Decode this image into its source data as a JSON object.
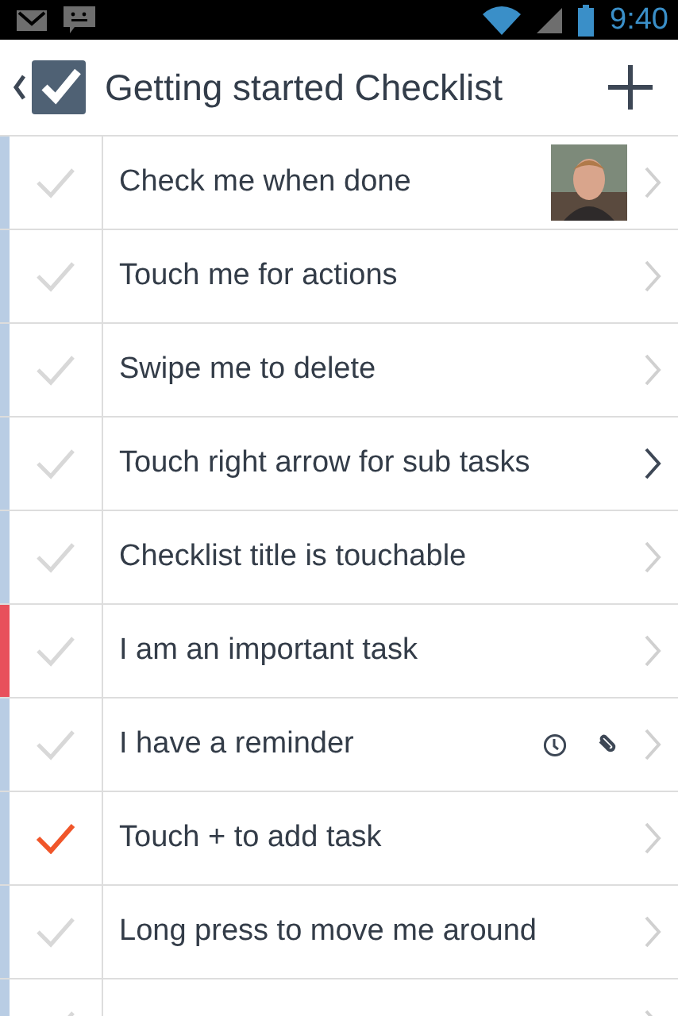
{
  "status_bar": {
    "time": "9:40"
  },
  "toolbar": {
    "title": "Getting started Checklist"
  },
  "tasks": [
    {
      "title": "Check me when done",
      "done": false,
      "color": "#b9cde4",
      "photo": true,
      "has_subtasks": false
    },
    {
      "title": "Touch me for actions",
      "done": false,
      "color": "#b9cde4",
      "has_subtasks": false
    },
    {
      "title": "Swipe me to delete",
      "done": false,
      "color": "#b9cde4",
      "has_subtasks": false
    },
    {
      "title": "Touch right arrow for sub tasks",
      "done": false,
      "color": "#b9cde4",
      "has_subtasks": true
    },
    {
      "title": "Checklist title is touchable",
      "done": false,
      "color": "#b9cde4",
      "has_subtasks": false
    },
    {
      "title": "I am an important task",
      "done": false,
      "color": "#e8505b",
      "has_subtasks": false
    },
    {
      "title": "I have a reminder",
      "done": false,
      "color": "#b9cde4",
      "reminder": true,
      "attachment": true,
      "has_subtasks": false
    },
    {
      "title": "Touch + to add task",
      "done": true,
      "color": "#b9cde4",
      "has_subtasks": false
    },
    {
      "title": "Long press to move me around",
      "done": false,
      "color": "#b9cde4",
      "has_subtasks": false
    },
    {
      "done": false,
      "color": "#b9cde4",
      "has_subtasks": false
    }
  ]
}
